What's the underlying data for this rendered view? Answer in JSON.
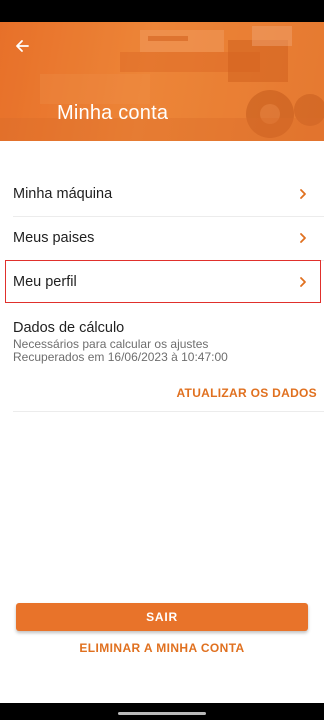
{
  "header": {
    "title": "Minha conta",
    "back_icon": "arrow-left-icon",
    "accent_color": "#e8732a"
  },
  "menu": {
    "items": [
      {
        "label": "Minha máquina",
        "icon": "chevron-right-icon"
      },
      {
        "label": "Meus paises",
        "icon": "chevron-right-icon"
      },
      {
        "label": "Meu perfil",
        "icon": "chevron-right-icon",
        "highlighted": true
      }
    ]
  },
  "calc": {
    "title": "Dados de cálculo",
    "subtitle": "Necessários para calcular os ajustes",
    "retrieved": "Recuperados em 16/06/2023 à 10:47:00",
    "update_label": "ATUALIZAR OS DADOS"
  },
  "actions": {
    "logout_label": "SAIR",
    "delete_label": "ELIMINAR A MINHA CONTA"
  }
}
